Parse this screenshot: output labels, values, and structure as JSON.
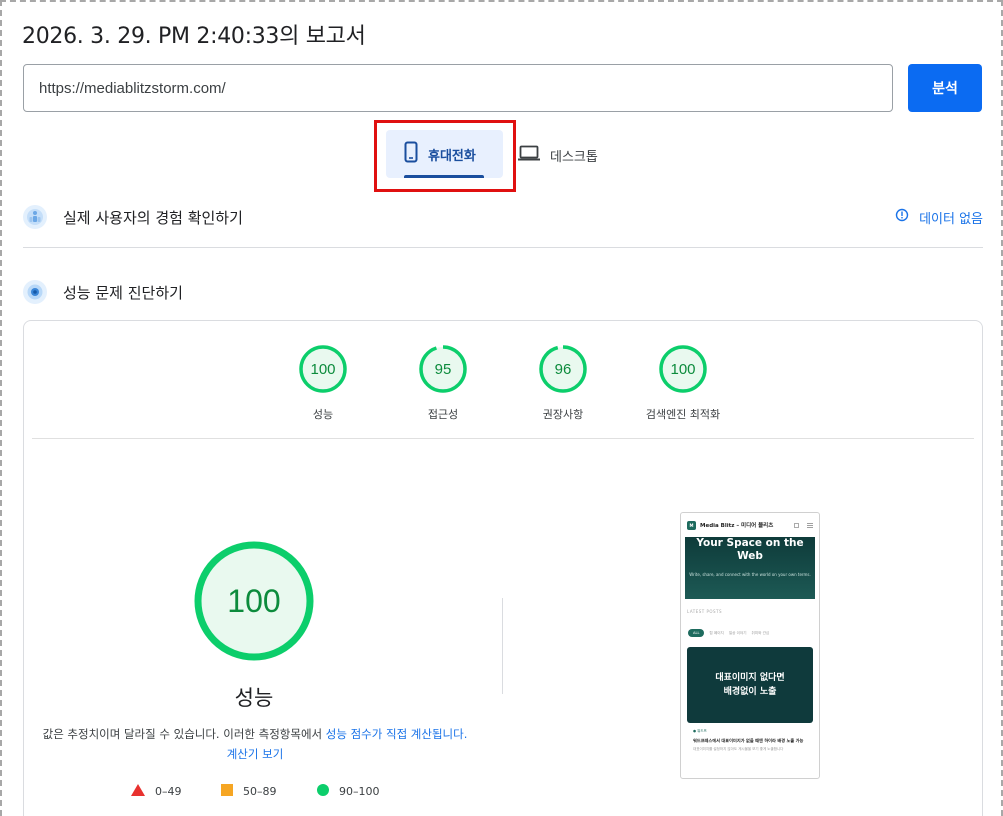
{
  "report": {
    "title": "2026. 3. 29. PM 2:40:33의 보고서"
  },
  "search": {
    "url": "https://mediablitzstorm.com/",
    "analyze_label": "분석"
  },
  "device_tabs": {
    "mobile_label": "휴대전화",
    "desktop_label": "데스크톱",
    "selected": "mobile"
  },
  "field_data": {
    "title": "실제 사용자의 경험 확인하기",
    "status": "데이터 없음"
  },
  "lab": {
    "title": "성능 문제 진단하기"
  },
  "category_scores": [
    {
      "label": "성능",
      "score": "100",
      "value": 100
    },
    {
      "label": "접근성",
      "score": "95",
      "value": 95
    },
    {
      "label": "권장사항",
      "score": "96",
      "value": 96
    },
    {
      "label": "검색엔진 최적화",
      "score": "100",
      "value": 100
    }
  ],
  "performance": {
    "score": "100",
    "value": 100,
    "label": "성능",
    "desc_text": "값은 추정치이며 달라질 수 있습니다. 이러한 측정항목에서 ",
    "desc_link1": "성능 점수가 직접 계산됩니다",
    "desc_link2": ".계산기 보기"
  },
  "legend": [
    {
      "range": "0–49",
      "color": "#e8312f"
    },
    {
      "range": "50–89",
      "color": "#f6a623"
    },
    {
      "range": "90–100",
      "color": "#0cce6b"
    }
  ],
  "colors": {
    "pass": "#0cce6b",
    "pass_text": "#0c8b3c",
    "link": "#1a73e8",
    "button": "#0b6bf2",
    "highlight": "#e01010"
  },
  "screenshot": {
    "site_name": "Media Blitz – 미디어 블리츠",
    "logo_text": "M",
    "hero_title": "Your Space on the Web",
    "hero_sub": "Write, share, and connect with the world on your own terms.",
    "section_label": "LATEST POSTS",
    "chips": [
      "ALL",
      "탑 페이지",
      "일상 이야기",
      "취미와 관심"
    ],
    "feature_text_1": "대표이미지 없다면",
    "feature_text_2": "배경없이 노출",
    "post_category": "● 워드프",
    "post_title": "워드프레스에서 대표이미지가 없을 때엔 하이라 배경 노출 가능",
    "post_excerpt": "대표이미지를 설정하지 않아도 게시물을 보기 좋게 노출합니다"
  }
}
